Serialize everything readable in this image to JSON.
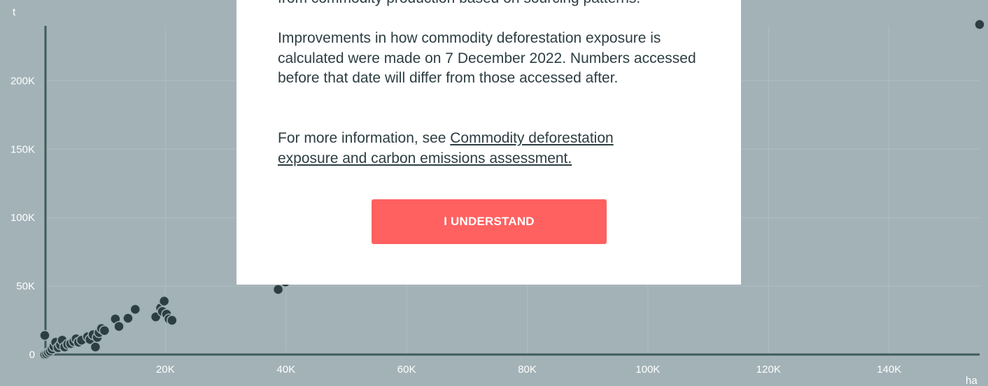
{
  "chart_data": {
    "type": "scatter",
    "xlabel": "ha",
    "ylabel": "t",
    "xlim": [
      0,
      155000
    ],
    "ylim": [
      0,
      240000
    ],
    "x_ticks": [
      20000,
      40000,
      60000,
      80000,
      100000,
      120000,
      140000
    ],
    "x_tick_labels": [
      "20K",
      "40K",
      "60K",
      "80K",
      "100K",
      "120K",
      "140K"
    ],
    "y_ticks": [
      0,
      50000,
      100000,
      150000,
      200000
    ],
    "y_tick_labels": [
      "0",
      "50K",
      "100K",
      "150K",
      "200K"
    ],
    "grid": true,
    "points": [
      {
        "x": 0,
        "y": 0
      },
      {
        "x": 300,
        "y": 500
      },
      {
        "x": 600,
        "y": 1500
      },
      {
        "x": 900,
        "y": 2500
      },
      {
        "x": 0,
        "y": 14000
      },
      {
        "x": 1200,
        "y": 4000
      },
      {
        "x": 1500,
        "y": 6000
      },
      {
        "x": 1800,
        "y": 9000
      },
      {
        "x": 2200,
        "y": 5000
      },
      {
        "x": 2600,
        "y": 7000
      },
      {
        "x": 2900,
        "y": 10500
      },
      {
        "x": 3300,
        "y": 5500
      },
      {
        "x": 3800,
        "y": 7500
      },
      {
        "x": 4300,
        "y": 8000
      },
      {
        "x": 4800,
        "y": 9500
      },
      {
        "x": 5200,
        "y": 11500
      },
      {
        "x": 5600,
        "y": 9000
      },
      {
        "x": 6100,
        "y": 10500
      },
      {
        "x": 7100,
        "y": 13000
      },
      {
        "x": 7500,
        "y": 11000
      },
      {
        "x": 8000,
        "y": 14500
      },
      {
        "x": 8400,
        "y": 5500
      },
      {
        "x": 8700,
        "y": 12500
      },
      {
        "x": 9000,
        "y": 16000
      },
      {
        "x": 9400,
        "y": 19000
      },
      {
        "x": 9900,
        "y": 17500
      },
      {
        "x": 11700,
        "y": 26000
      },
      {
        "x": 12300,
        "y": 20500
      },
      {
        "x": 13800,
        "y": 26500
      },
      {
        "x": 15000,
        "y": 33000
      },
      {
        "x": 18400,
        "y": 27500
      },
      {
        "x": 19200,
        "y": 34000
      },
      {
        "x": 19500,
        "y": 31500
      },
      {
        "x": 19800,
        "y": 39000
      },
      {
        "x": 20200,
        "y": 29500
      },
      {
        "x": 20600,
        "y": 26000
      },
      {
        "x": 21100,
        "y": 25000
      },
      {
        "x": 38700,
        "y": 47500
      },
      {
        "x": 39900,
        "y": 53000
      },
      {
        "x": 155000,
        "y": 241000
      }
    ]
  },
  "modal": {
    "partial_line": "from commodity production based on sourcing patterns.",
    "paragraph_update": "Improvements in how commodity deforestation exposure is calculated were made on 7 December 2022. Numbers accessed before that date will differ from those accessed after.",
    "more_info_prefix": "For more information, see ",
    "more_info_link": "Commodity deforestation exposure and carbon emissions assessment.",
    "button_label": "I UNDERSTAND"
  }
}
